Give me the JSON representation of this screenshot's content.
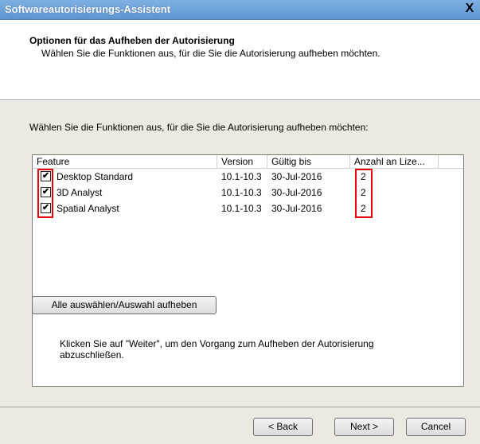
{
  "window": {
    "title": "Softwareautorisierungs-Assistent",
    "close_glyph": "X"
  },
  "header": {
    "title": "Optionen für das Aufheben der Autorisierung",
    "subtitle": "Wählen Sie die Funktionen aus, für die Sie die Autorisierung aufheben möchten."
  },
  "content": {
    "instruction": "Wählen Sie die Funktionen aus, für die Sie die Autorisierung aufheben möchten:",
    "columns": [
      "Feature",
      "Version",
      "Gültig bis",
      "Anzahl an Lize..."
    ],
    "rows": [
      {
        "checked": true,
        "feature": "Desktop Standard",
        "version": "10.1-10.3",
        "valid": "30-Jul-2016",
        "count": "2"
      },
      {
        "checked": true,
        "feature": "3D Analyst",
        "version": "10.1-10.3",
        "valid": "30-Jul-2016",
        "count": "2"
      },
      {
        "checked": true,
        "feature": "Spatial Analyst",
        "version": "10.1-10.3",
        "valid": "30-Jul-2016",
        "count": "2"
      }
    ],
    "select_all_label": "Alle auswählen/Auswahl aufheben",
    "footer_line1": "Klicken Sie auf \"Weiter\", um den Vorgang zum Aufheben der Autorisierung",
    "footer_line2": "abzuschließen."
  },
  "buttons": {
    "back": {
      "label": "< Back",
      "mnemonic_letter": "B"
    },
    "next": {
      "label": "Next >",
      "mnemonic_letter": "N"
    },
    "cancel": {
      "label": "Cancel"
    }
  },
  "colors": {
    "highlight": "#e8000d",
    "dialog_bg": "#ece9e1",
    "titlebar": "#6aa0d8"
  },
  "icons": {
    "check": "✔"
  }
}
